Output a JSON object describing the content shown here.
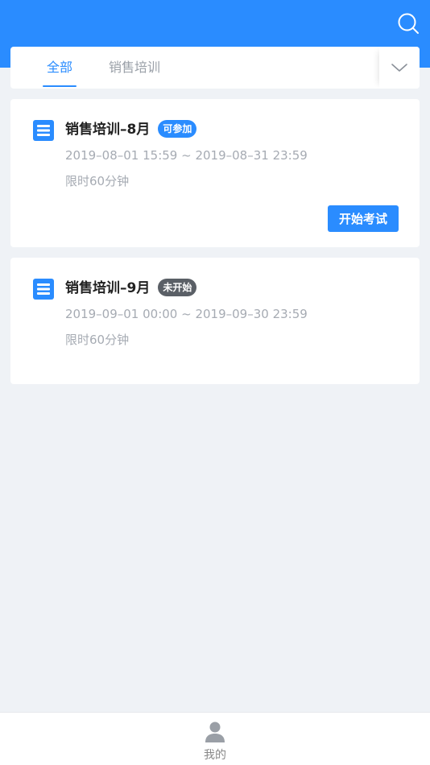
{
  "colors": {
    "header": "#2a8cff",
    "accent": "#2a8cff",
    "badge_available": "#2a8cff",
    "badge_not_started": "#5a5f66",
    "background": "#eff2f6"
  },
  "header": {
    "search_icon": "search-icon"
  },
  "tabs": [
    {
      "label": "全部",
      "active": true
    },
    {
      "label": "销售培训",
      "active": false
    }
  ],
  "tabs_expand_icon": "chevron-down-icon",
  "exams": [
    {
      "title": "销售培训–8月",
      "badge": "可参加",
      "time_range": "2019–08–01 15:59 ~ 2019–08–31 23:59",
      "time_limit": "限时60分钟",
      "action_label": "开始考试"
    },
    {
      "title": "销售培训–9月",
      "badge": "未开始",
      "time_range": "2019–09–01 00:00 ~ 2019–09–30 23:59",
      "time_limit": "限时60分钟"
    }
  ],
  "bottom_nav": {
    "me_label": "我的",
    "me_icon": "user-icon"
  }
}
